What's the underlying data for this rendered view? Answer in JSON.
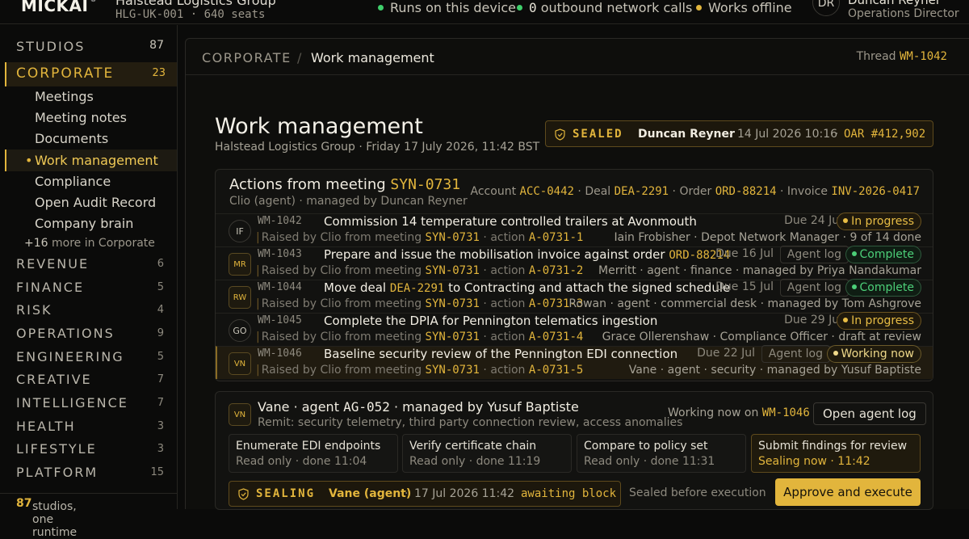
{
  "app": {
    "logo": "MICKAI",
    "logo_mark": "®",
    "org_name": "Halstead Logistics Group",
    "org_meta": "HLG-UK-001 · 640 seats"
  },
  "indicators": [
    {
      "label": "Runs on this device",
      "color": "#3fcf6b"
    },
    {
      "label": "0",
      "suffix": "outbound network calls",
      "color": "#3fcf6b"
    },
    {
      "label": "Works offline",
      "color": "#e2b53c"
    }
  ],
  "user": {
    "initials": "DR",
    "name": "Duncan Reyner",
    "role": "Operations Director"
  },
  "sidebar": {
    "studios_label": "STUDIOS",
    "studios_count": "87",
    "corporate": {
      "label": "CORPORATE",
      "count": "23"
    },
    "corporate_items": [
      "Meetings",
      "Meeting notes",
      "Documents",
      "Work management",
      "Compliance",
      "Open Audit Record",
      "Company brain"
    ],
    "more": {
      "count": "+16",
      "text": "more in Corporate"
    },
    "groups": [
      {
        "label": "REVENUE",
        "count": "6"
      },
      {
        "label": "FINANCE",
        "count": "5"
      },
      {
        "label": "RISK",
        "count": "4"
      },
      {
        "label": "OPERATIONS",
        "count": "9"
      },
      {
        "label": "ENGINEERING",
        "count": "5"
      },
      {
        "label": "CREATIVE",
        "count": "7"
      },
      {
        "label": "INTELLIGENCE",
        "count": "7"
      },
      {
        "label": "HEALTH",
        "count": "3"
      },
      {
        "label": "LIFESTYLE",
        "count": "3"
      },
      {
        "label": "PLATFORM",
        "count": "15"
      }
    ],
    "footer": {
      "count": "87",
      "text": "studios, one runtime"
    }
  },
  "breadcrumb": {
    "section": "CORPORATE",
    "sep": "/",
    "page": "Work management",
    "thread_label": "Thread",
    "thread_id": "WM-1042"
  },
  "page": {
    "title": "Work management",
    "subtitle": "Halstead Logistics Group · Friday 17 July 2026, 11:42 BST"
  },
  "seal": {
    "status": "SEALED",
    "by": "Duncan Reyner",
    "sep": "·",
    "when": "14 Jul 2026 10:16",
    "record": "OAR #412,902"
  },
  "actions": {
    "title": "Actions from meeting",
    "meeting_id": "SYN-0731",
    "subtitle": "Clio (agent) · managed by Duncan Reyner",
    "refs": [
      {
        "label": "Account",
        "id": "ACC-0442"
      },
      {
        "label": "Deal",
        "id": "DEA-2291"
      },
      {
        "label": "Order",
        "id": "ORD-88214"
      },
      {
        "label": "Invoice",
        "id": "INV-2026-0417"
      }
    ],
    "rows": [
      {
        "avatar": "IF",
        "id": "WM-1042",
        "title": "Commission 14 temperature controlled trailers at Avonmouth",
        "title_ref": "",
        "title_post": "",
        "due": "Due 24 Jul",
        "agent_log": "",
        "status": "In progress",
        "raised": "Raised by Clio from meeting",
        "meeting": "SYN-0731",
        "action_label": "· action",
        "action_id": "A-0731-1",
        "right": "Iain Frobisher · Depot Network Manager · 9 of 14 done"
      },
      {
        "avatar": "MR",
        "id": "WM-1043",
        "title": "Prepare and issue the mobilisation invoice against order",
        "title_ref": "ORD-88214",
        "title_post": "",
        "due": "Due 16 Jul",
        "agent_log": "Agent log",
        "status": "Complete",
        "raised": "Raised by Clio from meeting",
        "meeting": "SYN-0731",
        "action_label": "· action",
        "action_id": "A-0731-2",
        "right": "Merritt · agent · finance · managed by Priya Nandakumar"
      },
      {
        "avatar": "RW",
        "id": "WM-1044",
        "title": "Move deal",
        "title_ref": "DEA-2291",
        "title_post": "to Contracting and attach the signed schedule",
        "due": "Due 15 Jul",
        "agent_log": "Agent log",
        "status": "Complete",
        "raised": "Raised by Clio from meeting",
        "meeting": "SYN-0731",
        "action_label": "· action",
        "action_id": "A-0731-3",
        "right": "Rowan · agent · commercial desk · managed by Tom Ashgrove"
      },
      {
        "avatar": "GO",
        "id": "WM-1045",
        "title": "Complete the DPIA for Pennington telematics ingestion",
        "title_ref": "",
        "title_post": "",
        "due": "Due 29 Jul",
        "agent_log": "",
        "status": "In progress",
        "raised": "Raised by Clio from meeting",
        "meeting": "SYN-0731",
        "action_label": "· action",
        "action_id": "A-0731-4",
        "right": "Grace Ollerenshaw · Compliance Officer · draft at review"
      },
      {
        "avatar": "VN",
        "id": "WM-1046",
        "title": "Baseline security review of the Pennington EDI connection",
        "title_ref": "",
        "title_post": "",
        "due": "Due 22 Jul",
        "agent_log": "Agent log",
        "status": "Working now",
        "raised": "Raised by Clio from meeting",
        "meeting": "SYN-0731",
        "action_label": "· action",
        "action_id": "A-0731-5",
        "right": "Vane · agent · security · managed by Yusuf Baptiste"
      }
    ]
  },
  "agent": {
    "avatar": "VN",
    "name": "Vane · agent",
    "agent_id": "AG-052",
    "managed": "· managed by Yusuf Baptiste",
    "remit": "Remit: security telemetry, third party connection review, access anomalies",
    "working_label": "Working now on",
    "working_id": "WM-1046",
    "log_button": "Open agent log",
    "steps": [
      {
        "title": "Enumerate EDI endpoints",
        "meta": "Read only · done 11:04"
      },
      {
        "title": "Verify certificate chain",
        "meta": "Read only · done 11:19"
      },
      {
        "title": "Compare to policy set",
        "meta": "Read only · done 11:31"
      },
      {
        "title": "Submit findings for review",
        "meta": "Sealing now · 11:42"
      }
    ],
    "sealing": {
      "status": "SEALING",
      "by": "Vane (agent)",
      "sep": "·",
      "when": "17 Jul 2026 11:42",
      "state": "awaiting block"
    },
    "sealed_before": "Sealed before execution",
    "approve": "Approve and execute"
  },
  "colors": {
    "accent": "#e2b53c",
    "complete": "#4ccf78",
    "in_progress": "#e8bd45",
    "working": "#efd98a"
  }
}
